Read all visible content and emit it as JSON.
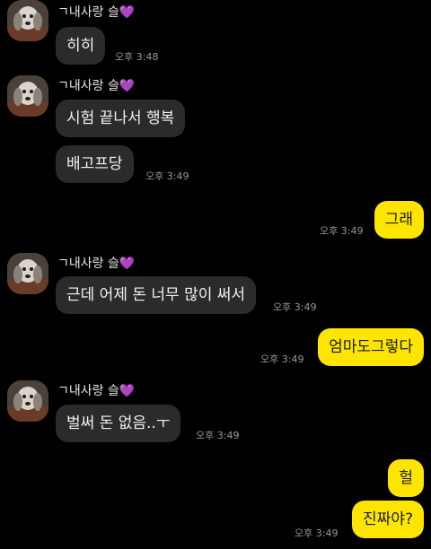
{
  "chat": {
    "sender_name": "ㄱ내사랑 슬",
    "sender_heart": "💜",
    "messages": [
      {
        "text": "히히",
        "time": "오후 3:48"
      },
      {
        "text": "시험 끝나서 행복"
      },
      {
        "text": "배고프당",
        "time": "오후 3:49"
      },
      {
        "text": "그래",
        "time": "오후 3:49"
      },
      {
        "text": "근데 어제 돈 너무 많이 써서",
        "time": "오후 3:49"
      },
      {
        "text": "엄마도그렇다",
        "time": "오후 3:49"
      },
      {
        "text": "벌써 돈 없음..ㅜ",
        "time": "오후 3:49"
      },
      {
        "text": "헐"
      },
      {
        "text": "진짜야?",
        "time": "오후 3:49"
      }
    ]
  },
  "colors": {
    "background": "#000000",
    "incoming_bubble": "#2b2b2b",
    "outgoing_bubble": "#fee500",
    "heart": "#8a3fd6"
  },
  "icons": {
    "avatar": "dog-profile-photo"
  }
}
